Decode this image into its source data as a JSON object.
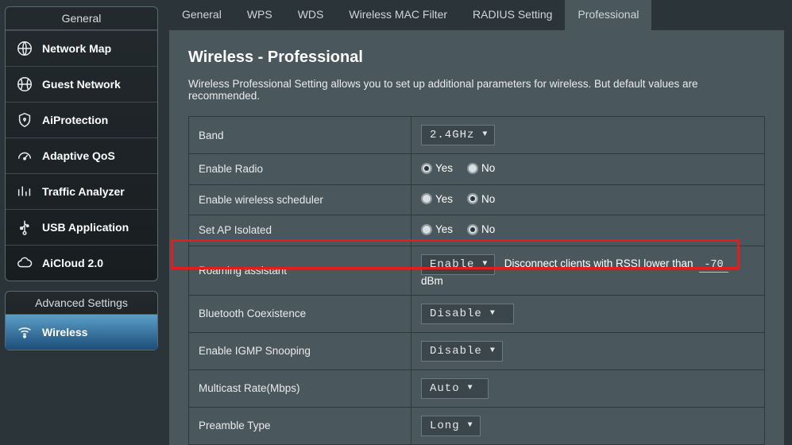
{
  "sidebar": {
    "general_heading": "General",
    "items": [
      {
        "label": "Network Map"
      },
      {
        "label": "Guest Network"
      },
      {
        "label": "AiProtection"
      },
      {
        "label": "Adaptive QoS"
      },
      {
        "label": "Traffic Analyzer"
      },
      {
        "label": "USB Application"
      },
      {
        "label": "AiCloud 2.0"
      }
    ],
    "advanced_heading": "Advanced Settings",
    "advanced_items": [
      {
        "label": "Wireless"
      }
    ]
  },
  "tabs": {
    "items": [
      {
        "label": "General"
      },
      {
        "label": "WPS"
      },
      {
        "label": "WDS"
      },
      {
        "label": "Wireless MAC Filter"
      },
      {
        "label": "RADIUS Setting"
      },
      {
        "label": "Professional"
      }
    ],
    "active_index": 5
  },
  "page": {
    "title": "Wireless - Professional",
    "description": "Wireless Professional Setting allows you to set up additional parameters for wireless. But default values are recommended."
  },
  "common": {
    "yes": "Yes",
    "no": "No",
    "dbm": "dBm"
  },
  "rows": {
    "band": {
      "label": "Band",
      "value": "2.4GHz"
    },
    "enable_radio": {
      "label": "Enable Radio",
      "value": "Yes"
    },
    "enable_sched": {
      "label": "Enable wireless scheduler",
      "value": "No"
    },
    "ap_isolated": {
      "label": "Set AP Isolated",
      "value": "No"
    },
    "roaming": {
      "label": "Roaming assistant",
      "select": "Enable",
      "hint": "Disconnect clients with RSSI lower than",
      "rssi": "-70"
    },
    "bt": {
      "label": "Bluetooth Coexistence",
      "value": "Disable"
    },
    "igmp": {
      "label": "Enable IGMP Snooping",
      "value": "Disable"
    },
    "mcast": {
      "label": "Multicast Rate(Mbps)",
      "value": "Auto"
    },
    "preamble": {
      "label": "Preamble Type",
      "value": "Long"
    }
  }
}
